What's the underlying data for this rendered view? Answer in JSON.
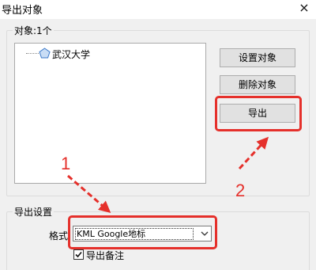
{
  "window": {
    "title": "导出对象",
    "close_symbol": "×"
  },
  "objects_group": {
    "label": "对象:1个",
    "items": [
      {
        "label": "武汉大学",
        "icon": "pentagon-icon"
      }
    ]
  },
  "buttons": {
    "set_object": "设置对象",
    "delete_object": "删除对象",
    "export": "导出"
  },
  "export_settings": {
    "label": "导出设置",
    "format_label": "格式",
    "format_value": "KML Google地标",
    "export_notes_label": "导出备注",
    "export_notes_checked": true
  },
  "annotations": {
    "step1": "1",
    "step2": "2",
    "highlight_color": "#e5302b"
  }
}
